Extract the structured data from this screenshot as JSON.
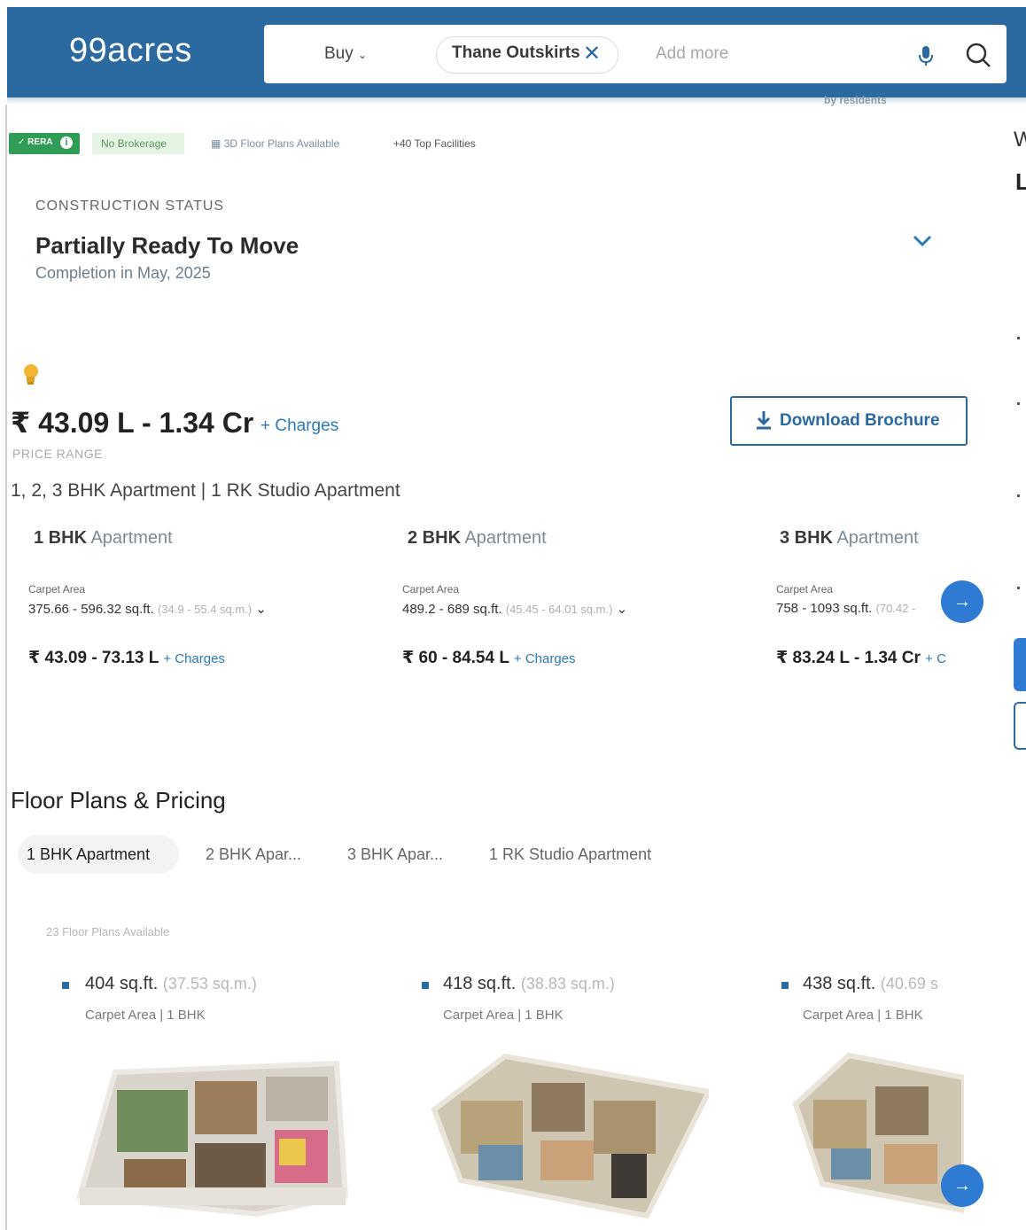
{
  "header": {
    "logo": "99acres",
    "buy_label": "Buy",
    "chip_label": "Thane Outskirts",
    "add_more_placeholder": "Add more",
    "behind_text": "by residents",
    "colors": {
      "brand": "#2a6aa1",
      "accent": "#2f7bd3"
    }
  },
  "badges": {
    "rera": "RERA",
    "no_brokerage": "No Brokerage",
    "floor_plans_3d": "3D Floor Plans Available",
    "top_facilities": "+40 Top Facilities"
  },
  "construction": {
    "label": "CONSTRUCTION STATUS",
    "status": "Partially Ready To Move",
    "completion": "Completion in May, 2025"
  },
  "price": {
    "range": "₹ 43.09 L - 1.34 Cr",
    "charges": "+ Charges",
    "label": "PRICE RANGE",
    "download_label": "Download Brochure"
  },
  "configurations": {
    "summary": "1, 2, 3 BHK Apartment | 1 RK Studio Apartment",
    "units": [
      {
        "bhk": "1 BHK",
        "type": "Apartment",
        "carpet_label": "Carpet Area",
        "area": "375.66 - 596.32 sq.ft.",
        "area_sqm": "(34.9 - 55.4 sq.m.)",
        "price": "₹ 43.09 - 73.13 L",
        "charges": "+ Charges"
      },
      {
        "bhk": "2 BHK",
        "type": "Apartment",
        "carpet_label": "Carpet Area",
        "area": "489.2 - 689 sq.ft.",
        "area_sqm": "(45.45 - 64.01 sq.m.)",
        "price": "₹ 60 - 84.54 L",
        "charges": "+ Charges"
      },
      {
        "bhk": "3 BHK",
        "type": "Apartment",
        "carpet_label": "Carpet Area",
        "area": "758 - 1093 sq.ft.",
        "area_sqm": "(70.42 -",
        "price": "₹ 83.24 L - 1.34 Cr",
        "charges": "+ C"
      }
    ]
  },
  "floor_plans": {
    "title": "Floor Plans & Pricing",
    "tabs": [
      "1 BHK Apartment",
      "2 BHK Apar...",
      "3 BHK Apar...",
      "1 RK Studio Apartment"
    ],
    "count": "23 Floor Plans Available",
    "plans": [
      {
        "area": "404 sq.ft.",
        "sqm": "(37.53 sq.m.)",
        "sub": "Carpet Area | 1 BHK"
      },
      {
        "area": "418 sq.ft.",
        "sqm": "(38.83 sq.m.)",
        "sub": "Carpet Area | 1 BHK"
      },
      {
        "area": "438 sq.ft.",
        "sqm": "(40.69 s",
        "sub": "Carpet Area | 1 BHK"
      }
    ]
  },
  "right_edge": {
    "w": "W",
    "l": "L"
  }
}
